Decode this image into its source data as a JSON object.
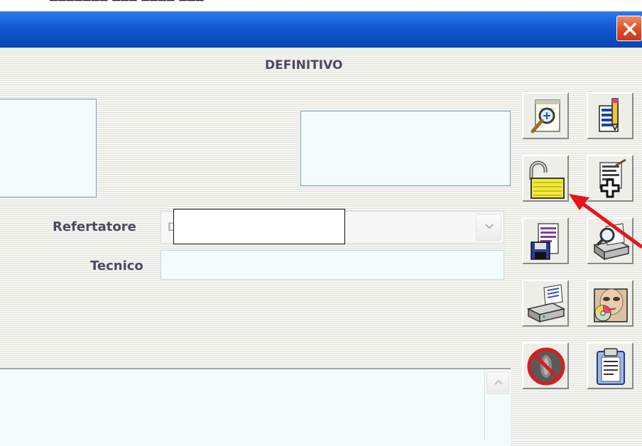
{
  "window": {
    "section_title": "DEFINITIVO",
    "close_glyph": "✕"
  },
  "form": {
    "refertatore_label": "Refertatore",
    "refertatore_partial_value": "D",
    "tecnico_label": "Tecnico",
    "tecnico_value": ""
  },
  "toolbar": {
    "buttons": [
      {
        "name": "preview-document",
        "icon": "magnifier-document-icon"
      },
      {
        "name": "edit-document",
        "icon": "pencil-document-icon"
      },
      {
        "name": "unlock",
        "icon": "open-padlock-icon"
      },
      {
        "name": "add-report",
        "icon": "document-plus-icon"
      },
      {
        "name": "save-report",
        "icon": "floppy-document-icon"
      },
      {
        "name": "print-preview",
        "icon": "printer-magnifier-icon"
      },
      {
        "name": "print",
        "icon": "printer-icon"
      },
      {
        "name": "patient-images",
        "icon": "face-cd-folder-icon"
      },
      {
        "name": "cancel-exam",
        "icon": "prohibited-xray-icon"
      },
      {
        "name": "clipboard",
        "icon": "clipboard-icon"
      }
    ]
  },
  "colors": {
    "title_bar": "#1560d8",
    "close_button": "#dc4d22",
    "annotation_arrow": "#e8141b",
    "field_background": "#f3fcfa"
  }
}
